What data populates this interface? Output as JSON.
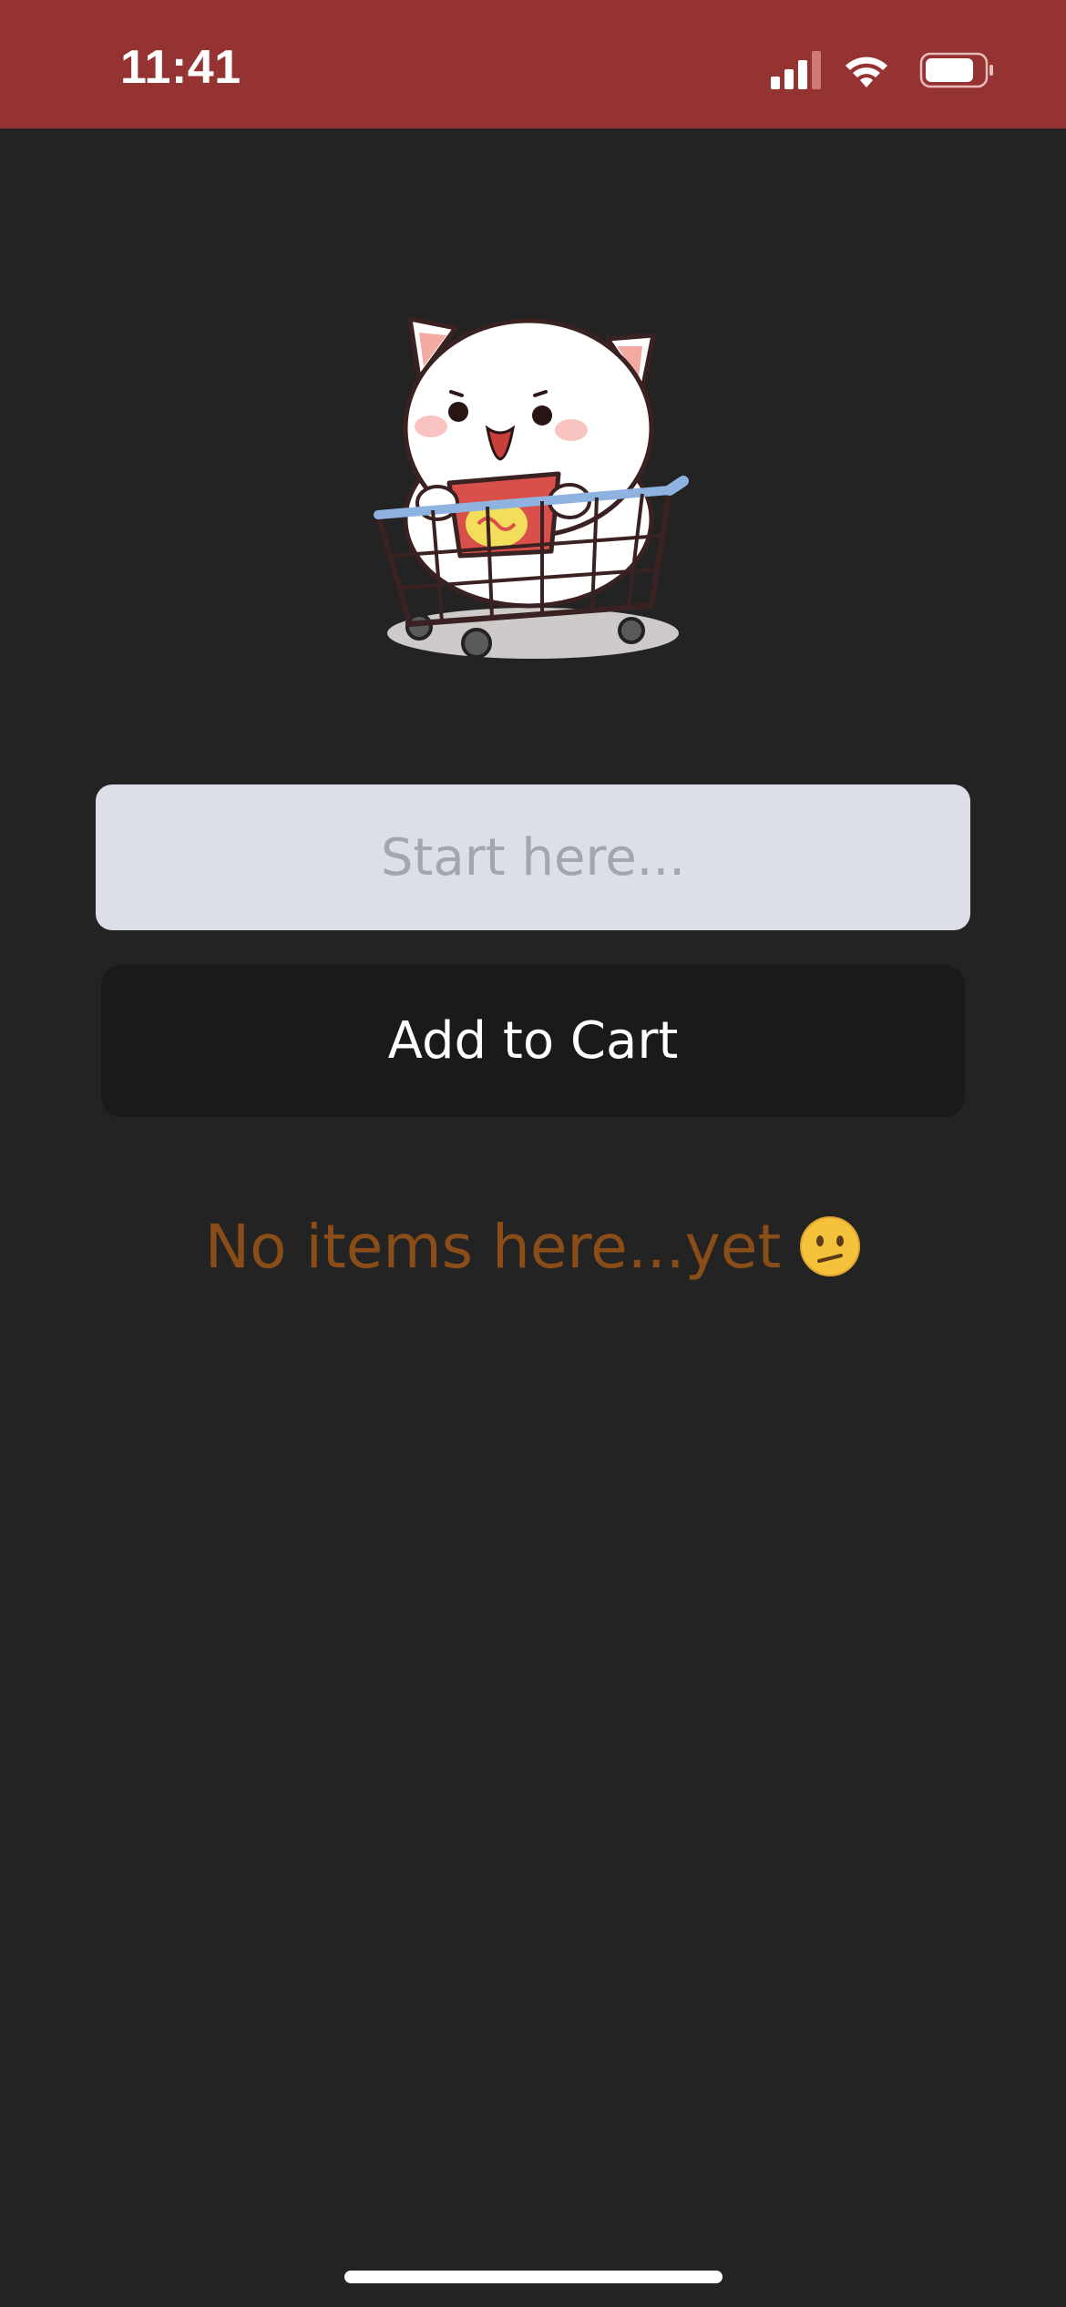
{
  "status_bar": {
    "time": "11:41",
    "background_color": "#943331",
    "icons": [
      "cellular-signal-icon",
      "wifi-icon",
      "battery-icon"
    ]
  },
  "mascot": {
    "icon": "cat-in-shopping-cart-illustration"
  },
  "item_input": {
    "value": "",
    "placeholder": "Start here..."
  },
  "add_button": {
    "label": "Add to Cart"
  },
  "empty_state": {
    "message": "No items here...yet",
    "emoji": "confused-face-emoji",
    "color": "#8a4d17"
  },
  "theme": {
    "background": "#232323",
    "button_background": "#1a1a1a",
    "input_background": "#dcdfe7"
  }
}
